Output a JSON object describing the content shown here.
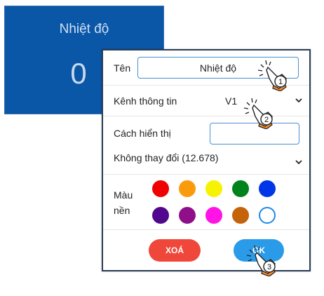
{
  "widget": {
    "title": "Nhiệt độ",
    "value": "0"
  },
  "dialog": {
    "name_label": "Tên",
    "name_value": "Nhiệt độ",
    "channel_label": "Kênh thông tin",
    "channel_value": "V1",
    "display_label": "Cách hiển thị",
    "display_value": "",
    "display_mode": "Không thay đổi (12.678)",
    "bg_label_line1": "Màu",
    "bg_label_line2": "nền",
    "colors": [
      "#f00000",
      "#fb9a0c",
      "#f7f300",
      "#00821c",
      "#0036e8",
      "#50078d",
      "#8f0f8b",
      "#ff13e5",
      "#c4630a",
      "#ffffff"
    ],
    "delete_label": "XOÁ",
    "ok_label": "OK"
  },
  "pointers": [
    "1",
    "2",
    "3"
  ]
}
